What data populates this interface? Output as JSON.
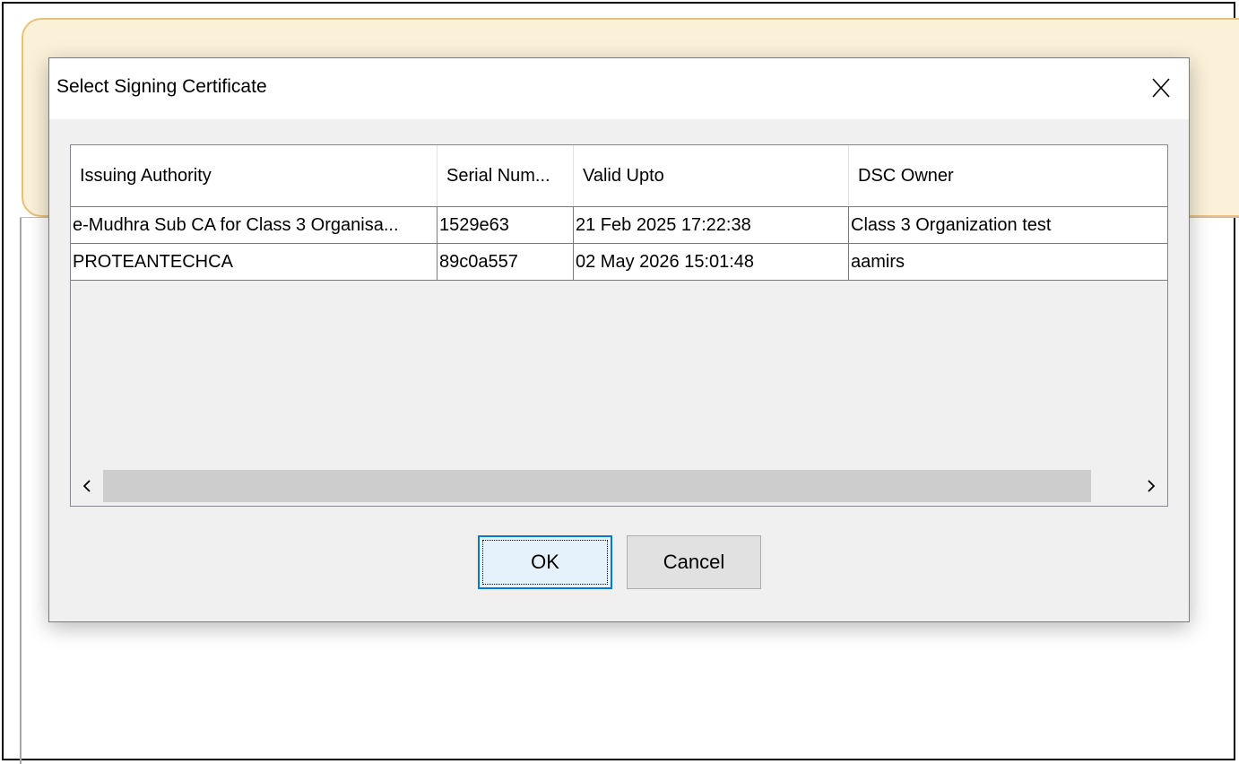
{
  "dialog": {
    "title": "Select Signing Certificate",
    "close_icon": "close-icon"
  },
  "table": {
    "columns": [
      "Issuing Authority",
      "Serial Num...",
      "Valid Upto",
      "DSC Owner"
    ],
    "rows": [
      {
        "issuing_authority": "e-Mudhra Sub CA for Class 3 Organisa...",
        "serial_number": "1529e63",
        "valid_upto": "21 Feb 2025 17:22:38",
        "dsc_owner": "Class 3 Organization test"
      },
      {
        "issuing_authority": "PROTEANTECHCA",
        "serial_number": "89c0a557",
        "valid_upto": "02 May 2026 15:01:48",
        "dsc_owner": "aamirs"
      }
    ],
    "scrollbar": {
      "left_arrow_icon": "chevron-left-icon",
      "right_arrow_icon": "chevron-right-icon"
    }
  },
  "buttons": {
    "ok_label": "OK",
    "cancel_label": "Cancel"
  },
  "colors": {
    "banner_bg": "#fbf1d9",
    "banner_border": "#e6c27a",
    "focus_border": "#0078d7"
  }
}
